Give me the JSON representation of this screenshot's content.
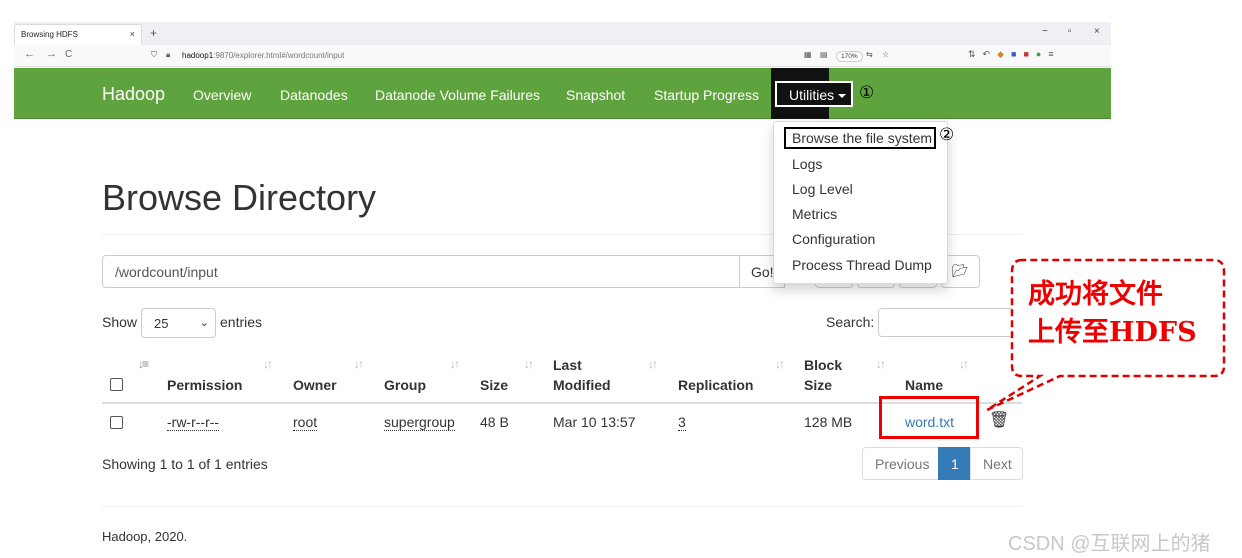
{
  "browser": {
    "tab_title": "Browsing HDFS",
    "tab_close": "×",
    "new_tab": "+",
    "win_min": "−",
    "win_max": "▫",
    "win_close": "×",
    "back": "←",
    "forward": "→",
    "reload": "C",
    "url_host": "hadoop1",
    "url_rest": ":9870/explorer.html#/wordcount/input",
    "zoom": "170%"
  },
  "navbar": {
    "brand": "Hadoop",
    "links": [
      "Overview",
      "Datanodes",
      "Datanode Volume Failures",
      "Snapshot",
      "Startup Progress"
    ],
    "utilities_label": "Utilities",
    "step1_marker": "①",
    "bg_color": "#5fa33e"
  },
  "dropdown": {
    "items": [
      "Browse the file system",
      "Logs",
      "Log Level",
      "Metrics",
      "Configuration",
      "Process Thread Dump"
    ],
    "step2_marker": "②"
  },
  "page": {
    "title": "Browse Directory",
    "path_value": "/wordcount/input",
    "go_label": "Go!",
    "show_label": "Show",
    "page_length": "25",
    "entries_label": "entries",
    "search_label": "Search:"
  },
  "table": {
    "headers": [
      "Permission",
      "Owner",
      "Group",
      "Size",
      "Last",
      "Modified",
      "Replication",
      "Block",
      "Size",
      "Name"
    ],
    "rows": [
      {
        "permission": "-rw-r--r--",
        "owner": "root",
        "group": "supergroup",
        "size": "48 B",
        "modified": "Mar 10 13:57",
        "replication": "3",
        "block_size": "128 MB",
        "name": "word.txt"
      }
    ]
  },
  "pagination": {
    "info": "Showing 1 to 1 of 1 entries",
    "previous": "Previous",
    "current": "1",
    "next": "Next"
  },
  "footer": {
    "text": "Hadoop, 2020."
  },
  "annotation": {
    "line1": "成功将文件",
    "line2": "上传至HDFS",
    "color": "#e00000"
  },
  "watermark": "CSDN @互联网上的猪"
}
